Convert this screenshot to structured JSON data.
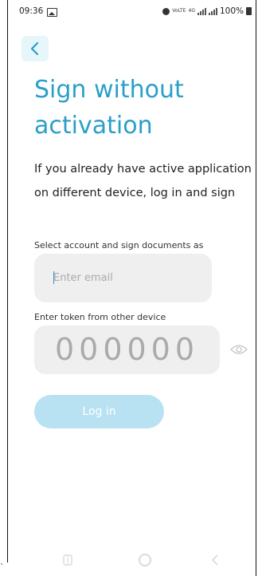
{
  "status_bar": {
    "time": "09:36",
    "network_text": "VoLTE",
    "network_type": "4G",
    "battery": "100%",
    "icons": [
      "image-icon",
      "alarm-icon",
      "signal-icon",
      "battery-icon"
    ]
  },
  "header": {
    "back_icon": "chevron-left-icon"
  },
  "title": "Sign without activation",
  "description": "If you already have active application on different device, log in and sign",
  "email": {
    "label": "Select account and sign documents as",
    "placeholder": "Enter email",
    "value": ""
  },
  "token": {
    "label": "Enter token from other device",
    "placeholder": "000000",
    "value": "",
    "visibility_icon": "eye-icon"
  },
  "login_button": {
    "label": "Log in",
    "enabled": false
  },
  "colors": {
    "accent": "#2a9fc8",
    "button_disabled": "#b8e2f2",
    "field_bg": "#efefef",
    "back_bg": "#e6f6fb"
  },
  "nav_bar": {
    "icons": [
      "recents-icon",
      "home-icon",
      "back-nav-icon"
    ]
  }
}
